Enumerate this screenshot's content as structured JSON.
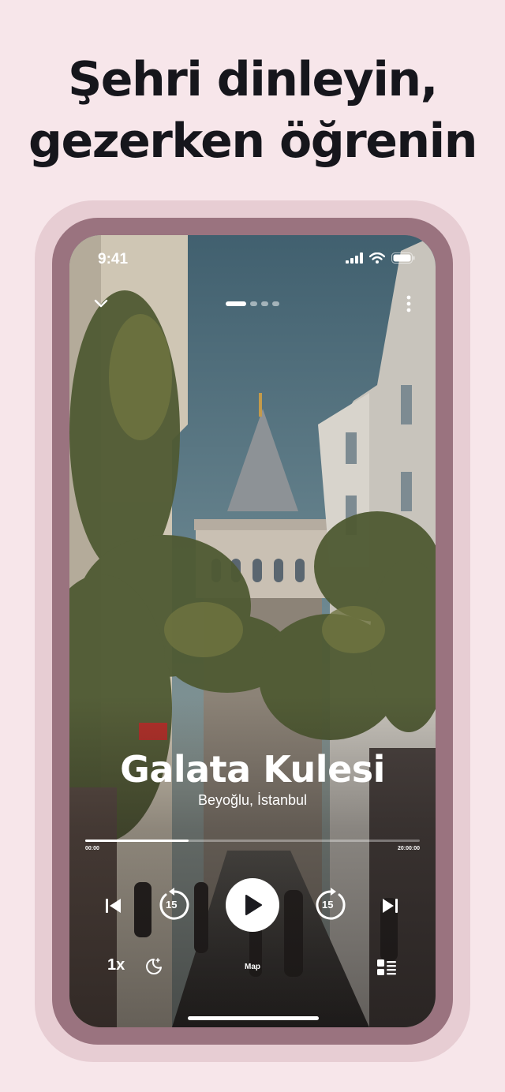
{
  "headline": {
    "line1": "Şehri dinleyin,",
    "line2": "gezerken öğrenin"
  },
  "status_bar": {
    "time": "9:41",
    "icons": [
      "signal-icon",
      "wifi-icon",
      "battery-icon"
    ]
  },
  "top_bar": {
    "collapse_icon": "chevron-down-icon",
    "page_indicator": {
      "count": 4,
      "active_index": 0
    },
    "menu_icon": "more-vertical-icon"
  },
  "place": {
    "title": "Galata Kulesi",
    "location": "Beyoğlu, İstanbul"
  },
  "player": {
    "progress": 0.31,
    "elapsed": "00:00",
    "total": "20:00:00",
    "skip_back_seconds": "15",
    "skip_forward_seconds": "15",
    "speed": "1x",
    "map_label": "Map",
    "icons": [
      "previous-icon",
      "rewind-15-icon",
      "play-icon",
      "forward-15-icon",
      "next-icon",
      "sleep-timer-icon",
      "playlist-icon"
    ]
  },
  "colors": {
    "background": "#f7e6ea",
    "frame": "#9a737f",
    "halo": "#e7cdd3",
    "text_dark": "#16161c"
  }
}
